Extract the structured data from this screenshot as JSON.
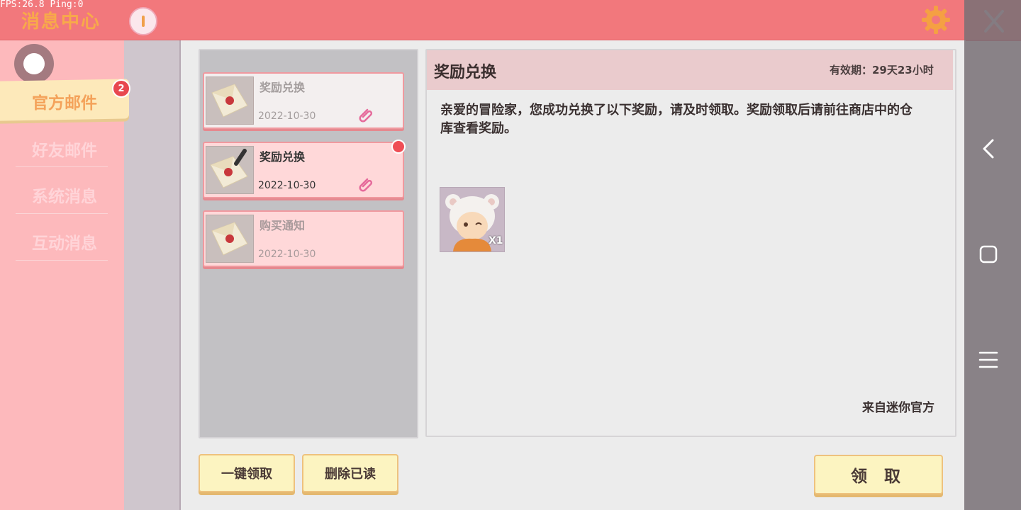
{
  "status": {
    "fps_text": "FPS:26.8  Ping:0"
  },
  "header": {
    "title": "消息中心",
    "alert_icon": "exclamation-icon",
    "settings_icon": "gear-icon",
    "close_icon": "close-icon"
  },
  "sidebar": {
    "items": [
      {
        "label": "官方邮件",
        "active": true,
        "badge": "2"
      },
      {
        "label": "好友邮件",
        "active": false
      },
      {
        "label": "系统消息",
        "active": false
      },
      {
        "label": "互动消息",
        "active": false
      }
    ]
  },
  "mail_list": [
    {
      "title": "奖励兑换",
      "date": "2022-10-30",
      "state": "read",
      "has_attachment": true
    },
    {
      "title": "奖励兑换",
      "date": "2022-10-30",
      "state": "unread-selected",
      "has_attachment": true,
      "new": true
    },
    {
      "title": "购买通知",
      "date": "2022-10-30",
      "state": "unread",
      "has_attachment": false
    }
  ],
  "buttons": {
    "claim_all": "一键领取",
    "delete_read": "删除已读",
    "claim": "领 取"
  },
  "detail": {
    "title": "奖励兑换",
    "expiry": "有效期：29天23小时",
    "body": "亲爱的冒险家，您成功兑换了以下奖励，请及时领取。奖励领取后请前往商店中的仓库查看奖励。",
    "reward_qty": "X1",
    "sender": "来自迷你官方"
  },
  "colors": {
    "topbar": "#f2787c",
    "title_orange": "#f8a94a",
    "sidebar_bg": "#fdb9bc",
    "button_fill": "#fcf4c1",
    "badge_red": "#e8484f"
  },
  "system_nav": [
    "back-icon",
    "home-icon",
    "menu-icon"
  ]
}
